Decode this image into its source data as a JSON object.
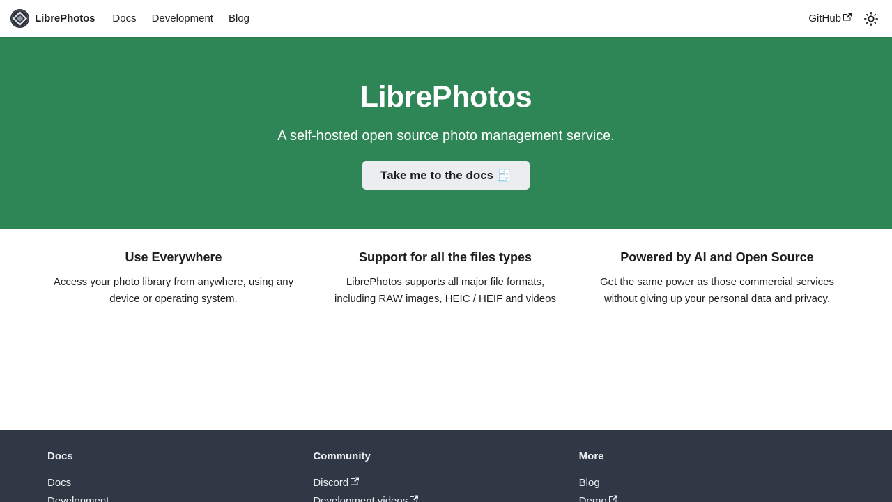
{
  "navbar": {
    "brand_name": "LibrePhotos",
    "links": [
      {
        "label": "Docs"
      },
      {
        "label": "Development"
      },
      {
        "label": "Blog"
      }
    ],
    "github_label": "GitHub",
    "icons": {
      "logo": "librephotos-logo-icon",
      "external": "external-link-icon",
      "theme": "sun-icon"
    }
  },
  "hero": {
    "title": "LibrePhotos",
    "subtitle": "A self-hosted open source photo management service.",
    "button_label": "Take me to the docs 🧾"
  },
  "features": [
    {
      "title": "Use Everywhere",
      "line1": "Access your photo library from anywhere, using any",
      "line2": "device or operating system."
    },
    {
      "title": "Support for all the files types",
      "line1": "LibrePhotos supports all major file formats,",
      "line2": "including RAW images, HEIC / HEIF and videos"
    },
    {
      "title": "Powered by AI and Open Source",
      "line1": "Get the same power as those commercial services",
      "line2": "without giving up your personal data and privacy."
    }
  ],
  "footer": {
    "columns": [
      {
        "title": "Docs",
        "links": [
          "Docs",
          "Development"
        ]
      },
      {
        "title": "Community",
        "links": [
          "Discord",
          "Development videos"
        ]
      },
      {
        "title": "More",
        "links": [
          "Blog",
          "Demo"
        ]
      }
    ]
  },
  "colors": {
    "primary": "#2e8555",
    "footer_bg": "#303846",
    "button_bg": "#ebedf0"
  }
}
